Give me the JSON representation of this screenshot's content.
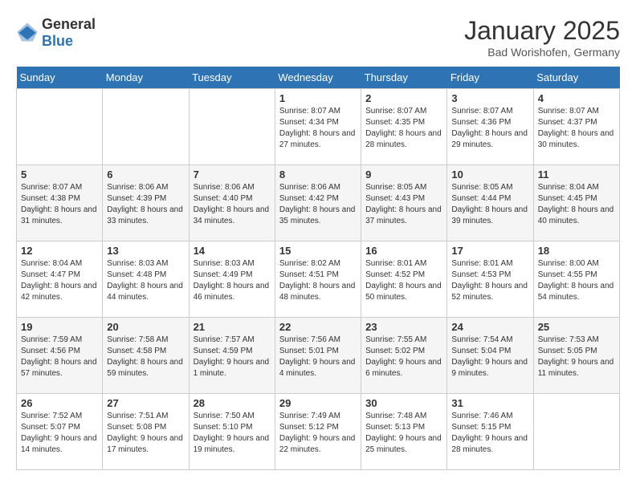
{
  "header": {
    "logo_general": "General",
    "logo_blue": "Blue",
    "title": "January 2025",
    "subtitle": "Bad Worishofen, Germany"
  },
  "weekdays": [
    "Sunday",
    "Monday",
    "Tuesday",
    "Wednesday",
    "Thursday",
    "Friday",
    "Saturday"
  ],
  "weeks": [
    [
      {
        "day": "",
        "content": ""
      },
      {
        "day": "",
        "content": ""
      },
      {
        "day": "",
        "content": ""
      },
      {
        "day": "1",
        "content": "Sunrise: 8:07 AM\nSunset: 4:34 PM\nDaylight: 8 hours and 27 minutes."
      },
      {
        "day": "2",
        "content": "Sunrise: 8:07 AM\nSunset: 4:35 PM\nDaylight: 8 hours and 28 minutes."
      },
      {
        "day": "3",
        "content": "Sunrise: 8:07 AM\nSunset: 4:36 PM\nDaylight: 8 hours and 29 minutes."
      },
      {
        "day": "4",
        "content": "Sunrise: 8:07 AM\nSunset: 4:37 PM\nDaylight: 8 hours and 30 minutes."
      }
    ],
    [
      {
        "day": "5",
        "content": "Sunrise: 8:07 AM\nSunset: 4:38 PM\nDaylight: 8 hours and 31 minutes."
      },
      {
        "day": "6",
        "content": "Sunrise: 8:06 AM\nSunset: 4:39 PM\nDaylight: 8 hours and 33 minutes."
      },
      {
        "day": "7",
        "content": "Sunrise: 8:06 AM\nSunset: 4:40 PM\nDaylight: 8 hours and 34 minutes."
      },
      {
        "day": "8",
        "content": "Sunrise: 8:06 AM\nSunset: 4:42 PM\nDaylight: 8 hours and 35 minutes."
      },
      {
        "day": "9",
        "content": "Sunrise: 8:05 AM\nSunset: 4:43 PM\nDaylight: 8 hours and 37 minutes."
      },
      {
        "day": "10",
        "content": "Sunrise: 8:05 AM\nSunset: 4:44 PM\nDaylight: 8 hours and 39 minutes."
      },
      {
        "day": "11",
        "content": "Sunrise: 8:04 AM\nSunset: 4:45 PM\nDaylight: 8 hours and 40 minutes."
      }
    ],
    [
      {
        "day": "12",
        "content": "Sunrise: 8:04 AM\nSunset: 4:47 PM\nDaylight: 8 hours and 42 minutes."
      },
      {
        "day": "13",
        "content": "Sunrise: 8:03 AM\nSunset: 4:48 PM\nDaylight: 8 hours and 44 minutes."
      },
      {
        "day": "14",
        "content": "Sunrise: 8:03 AM\nSunset: 4:49 PM\nDaylight: 8 hours and 46 minutes."
      },
      {
        "day": "15",
        "content": "Sunrise: 8:02 AM\nSunset: 4:51 PM\nDaylight: 8 hours and 48 minutes."
      },
      {
        "day": "16",
        "content": "Sunrise: 8:01 AM\nSunset: 4:52 PM\nDaylight: 8 hours and 50 minutes."
      },
      {
        "day": "17",
        "content": "Sunrise: 8:01 AM\nSunset: 4:53 PM\nDaylight: 8 hours and 52 minutes."
      },
      {
        "day": "18",
        "content": "Sunrise: 8:00 AM\nSunset: 4:55 PM\nDaylight: 8 hours and 54 minutes."
      }
    ],
    [
      {
        "day": "19",
        "content": "Sunrise: 7:59 AM\nSunset: 4:56 PM\nDaylight: 8 hours and 57 minutes."
      },
      {
        "day": "20",
        "content": "Sunrise: 7:58 AM\nSunset: 4:58 PM\nDaylight: 8 hours and 59 minutes."
      },
      {
        "day": "21",
        "content": "Sunrise: 7:57 AM\nSunset: 4:59 PM\nDaylight: 9 hours and 1 minute."
      },
      {
        "day": "22",
        "content": "Sunrise: 7:56 AM\nSunset: 5:01 PM\nDaylight: 9 hours and 4 minutes."
      },
      {
        "day": "23",
        "content": "Sunrise: 7:55 AM\nSunset: 5:02 PM\nDaylight: 9 hours and 6 minutes."
      },
      {
        "day": "24",
        "content": "Sunrise: 7:54 AM\nSunset: 5:04 PM\nDaylight: 9 hours and 9 minutes."
      },
      {
        "day": "25",
        "content": "Sunrise: 7:53 AM\nSunset: 5:05 PM\nDaylight: 9 hours and 11 minutes."
      }
    ],
    [
      {
        "day": "26",
        "content": "Sunrise: 7:52 AM\nSunset: 5:07 PM\nDaylight: 9 hours and 14 minutes."
      },
      {
        "day": "27",
        "content": "Sunrise: 7:51 AM\nSunset: 5:08 PM\nDaylight: 9 hours and 17 minutes."
      },
      {
        "day": "28",
        "content": "Sunrise: 7:50 AM\nSunset: 5:10 PM\nDaylight: 9 hours and 19 minutes."
      },
      {
        "day": "29",
        "content": "Sunrise: 7:49 AM\nSunset: 5:12 PM\nDaylight: 9 hours and 22 minutes."
      },
      {
        "day": "30",
        "content": "Sunrise: 7:48 AM\nSunset: 5:13 PM\nDaylight: 9 hours and 25 minutes."
      },
      {
        "day": "31",
        "content": "Sunrise: 7:46 AM\nSunset: 5:15 PM\nDaylight: 9 hours and 28 minutes."
      },
      {
        "day": "",
        "content": ""
      }
    ]
  ]
}
